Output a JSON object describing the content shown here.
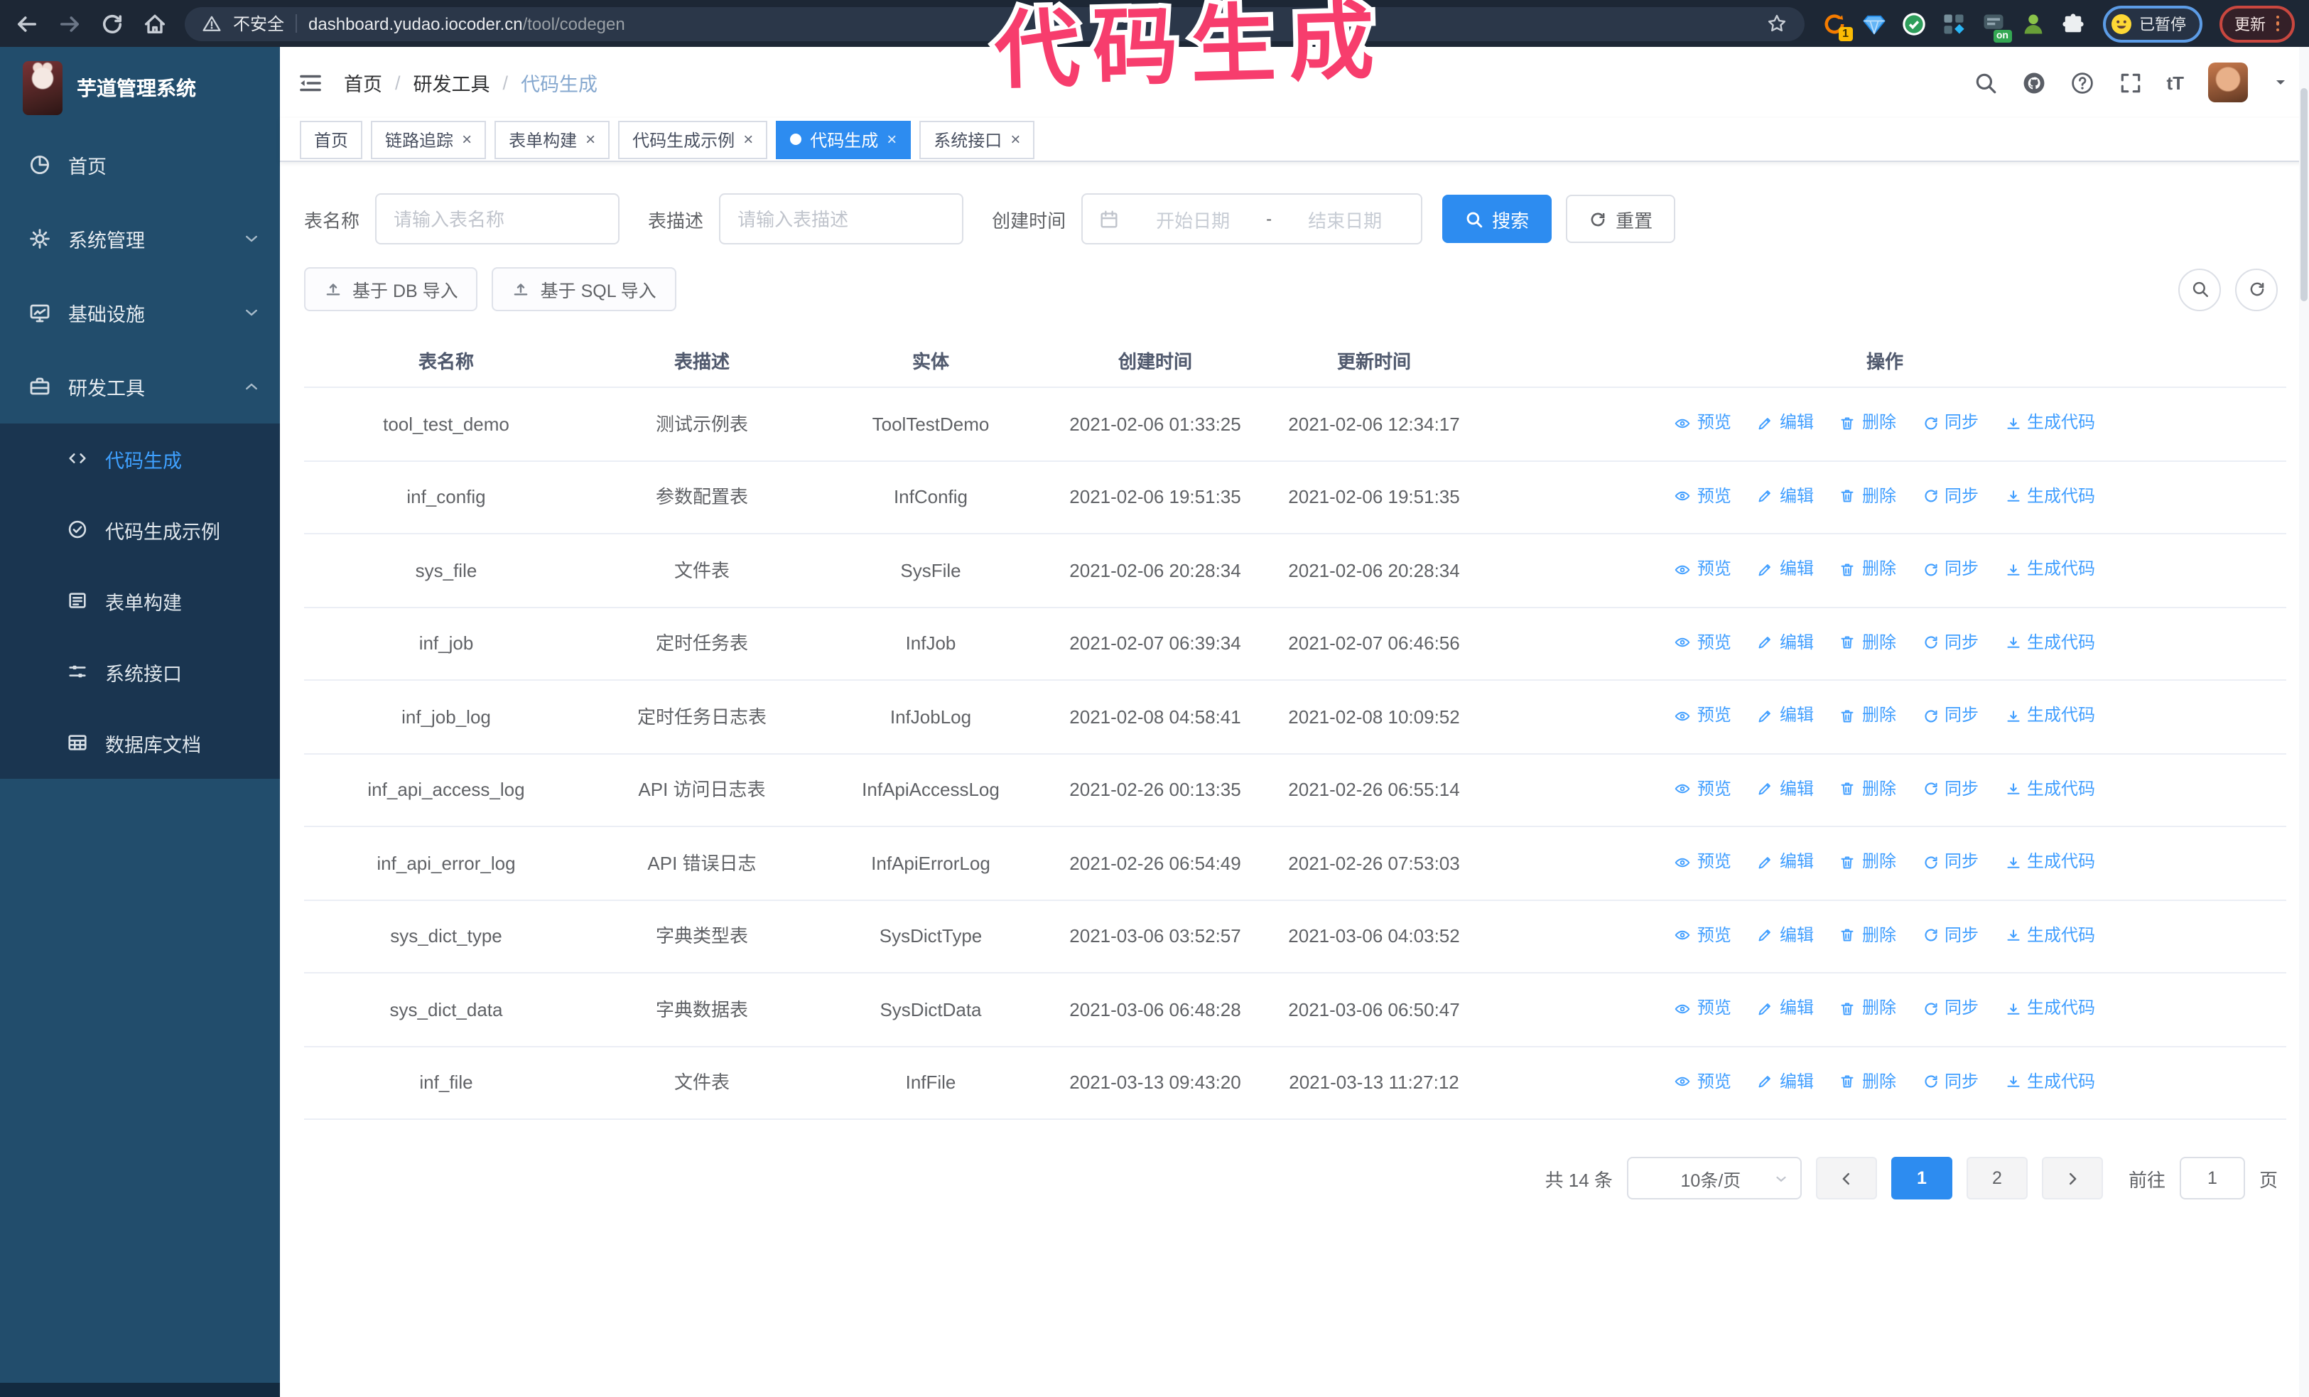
{
  "browser": {
    "security_label": "不安全",
    "url_domain": "dashboard.yudao.iocoder.cn",
    "url_path": "/tool/codegen",
    "ext_badge": "1",
    "ext_on_label": "on",
    "profile_label": "已暂停",
    "update_label": "更新"
  },
  "annotation": {
    "text": "代码生成",
    "color": "#f73d6d"
  },
  "sidebar": {
    "app_title": "芋道管理系统",
    "items": [
      {
        "key": "home",
        "label": "首页",
        "icon": "dashboard-icon"
      },
      {
        "key": "system-admin",
        "label": "系统管理",
        "icon": "gear-icon",
        "chevron": "down"
      },
      {
        "key": "infrastructure",
        "label": "基础设施",
        "icon": "monitor-icon",
        "chevron": "down"
      },
      {
        "key": "dev-tools",
        "label": "研发工具",
        "icon": "toolbox-icon",
        "chevron": "up"
      }
    ],
    "sub_items": [
      {
        "key": "codegen",
        "label": "代码生成",
        "icon": "code-icon",
        "active": true
      },
      {
        "key": "codegen-demo",
        "label": "代码生成示例",
        "icon": "example-icon"
      },
      {
        "key": "form-builder",
        "label": "表单构建",
        "icon": "form-icon"
      },
      {
        "key": "system-api",
        "label": "系统接口",
        "icon": "api-icon"
      },
      {
        "key": "db-doc",
        "label": "数据库文档",
        "icon": "dbdoc-icon"
      }
    ]
  },
  "header": {
    "breadcrumb": [
      "首页",
      "研发工具",
      "代码生成"
    ],
    "font_size_icon_label": "tT"
  },
  "tabs": [
    {
      "key": "home",
      "label": "首页",
      "closable": false
    },
    {
      "key": "tracing",
      "label": "链路追踪",
      "closable": true
    },
    {
      "key": "form-builder",
      "label": "表单构建",
      "closable": true
    },
    {
      "key": "codegen-demo",
      "label": "代码生成示例",
      "closable": true
    },
    {
      "key": "codegen",
      "label": "代码生成",
      "closable": true,
      "active": true
    },
    {
      "key": "system-api",
      "label": "系统接口",
      "closable": true
    }
  ],
  "search": {
    "name_label": "表名称",
    "name_placeholder": "请输入表名称",
    "desc_label": "表描述",
    "desc_placeholder": "请输入表描述",
    "time_label": "创建时间",
    "start_placeholder": "开始日期",
    "range_separator": "-",
    "end_placeholder": "结束日期",
    "search_label": "搜索",
    "reset_label": "重置"
  },
  "toolbar": {
    "import_db_label": "基于 DB 导入",
    "import_sql_label": "基于 SQL 导入"
  },
  "table": {
    "columns": [
      "表名称",
      "表描述",
      "实体",
      "创建时间",
      "更新时间",
      "操作"
    ],
    "actions": [
      {
        "key": "preview",
        "label": "预览",
        "icon": "eye-icon"
      },
      {
        "key": "edit",
        "label": "编辑",
        "icon": "edit-icon"
      },
      {
        "key": "delete",
        "label": "删除",
        "icon": "delete-icon"
      },
      {
        "key": "sync",
        "label": "同步",
        "icon": "sync-icon"
      },
      {
        "key": "generate",
        "label": "生成代码",
        "icon": "download-icon"
      }
    ],
    "rows": [
      {
        "name": "tool_test_demo",
        "desc": "测试示例表",
        "entity": "ToolTestDemo",
        "created": "2021-02-06 01:33:25",
        "updated": "2021-02-06 12:34:17"
      },
      {
        "name": "inf_config",
        "desc": "参数配置表",
        "entity": "InfConfig",
        "created": "2021-02-06 19:51:35",
        "updated": "2021-02-06 19:51:35"
      },
      {
        "name": "sys_file",
        "desc": "文件表",
        "entity": "SysFile",
        "created": "2021-02-06 20:28:34",
        "updated": "2021-02-06 20:28:34"
      },
      {
        "name": "inf_job",
        "desc": "定时任务表",
        "entity": "InfJob",
        "created": "2021-02-07 06:39:34",
        "updated": "2021-02-07 06:46:56"
      },
      {
        "name": "inf_job_log",
        "desc": "定时任务日志表",
        "entity": "InfJobLog",
        "created": "2021-02-08 04:58:41",
        "updated": "2021-02-08 10:09:52"
      },
      {
        "name": "inf_api_access_log",
        "desc": "API 访问日志表",
        "entity": "InfApiAccessLog",
        "created": "2021-02-26 00:13:35",
        "updated": "2021-02-26 06:55:14"
      },
      {
        "name": "inf_api_error_log",
        "desc": "API 错误日志",
        "entity": "InfApiErrorLog",
        "created": "2021-02-26 06:54:49",
        "updated": "2021-02-26 07:53:03"
      },
      {
        "name": "sys_dict_type",
        "desc": "字典类型表",
        "entity": "SysDictType",
        "created": "2021-03-06 03:52:57",
        "updated": "2021-03-06 04:03:52"
      },
      {
        "name": "sys_dict_data",
        "desc": "字典数据表",
        "entity": "SysDictData",
        "created": "2021-03-06 06:48:28",
        "updated": "2021-03-06 06:50:47"
      },
      {
        "name": "inf_file",
        "desc": "文件表",
        "entity": "InfFile",
        "created": "2021-03-13 09:43:20",
        "updated": "2021-03-13 11:27:12"
      }
    ]
  },
  "pagination": {
    "total_label": "共 14 条",
    "page_size_label": "10条/页",
    "pages": [
      "1",
      "2"
    ],
    "active_page": "1",
    "goto_label": "前往",
    "goto_value": "1",
    "unit_label": "页"
  },
  "colors": {
    "accent": "#409eff",
    "tab_active": "#2d8cf0",
    "sidebar_bg": "#224d6c",
    "submenu_bg": "#1a3550",
    "browser_bar_bg": "#1d2735",
    "annotation": "#f73d6d"
  }
}
